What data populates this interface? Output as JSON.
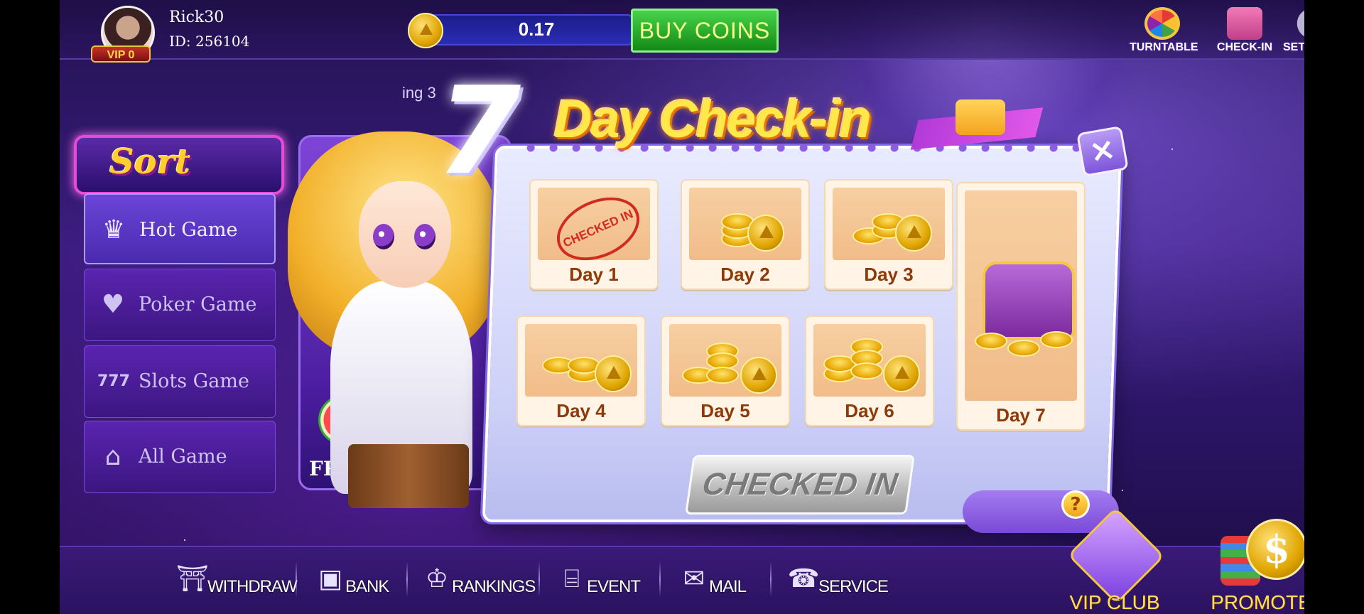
{
  "user": {
    "name": "Rick30",
    "id": "ID: 256104",
    "vip": "VIP 0"
  },
  "wallet": {
    "balance": "0.17",
    "buy_label": "BUY COINS"
  },
  "top_icons": [
    {
      "label": "TURNTABLE",
      "icon": "wheel-icon"
    },
    {
      "label": "CHECK-IN",
      "icon": "calendar-gift-icon"
    },
    {
      "label": "SETTINGS",
      "icon": "gear-icon"
    }
  ],
  "marquee": "ing 3",
  "sort": {
    "title": "Sort",
    "items": [
      {
        "label": "Hot Game",
        "icon": "crown-icon",
        "active": true
      },
      {
        "label": "Poker Game",
        "icon": "poker-card-icon",
        "active": false
      },
      {
        "label": "Slots Game",
        "icon": "slot-777-icon",
        "active": false
      },
      {
        "label": "All Game",
        "icon": "home-icon",
        "active": false
      }
    ]
  },
  "game_card": {
    "label": "FRU"
  },
  "checkin": {
    "title_number": "7",
    "title_text": "Day Check-in",
    "days": [
      {
        "label": "Day 1",
        "checked": true,
        "stamp": "CHECKED IN"
      },
      {
        "label": "Day 2",
        "checked": false
      },
      {
        "label": "Day 3",
        "checked": false
      },
      {
        "label": "Day 4",
        "checked": false
      },
      {
        "label": "Day 5",
        "checked": false
      },
      {
        "label": "Day 6",
        "checked": false
      },
      {
        "label": "Day 7",
        "checked": false
      }
    ],
    "button_label": "CHECKED IN",
    "help_label": "?",
    "close_label": "×"
  },
  "bottom_nav": [
    {
      "label": "WITHDRAW",
      "icon": "withdraw-icon"
    },
    {
      "label": "BANK",
      "icon": "safe-icon"
    },
    {
      "label": "RANKINGS",
      "icon": "trophy-icon"
    },
    {
      "label": "EVENT",
      "icon": "gift-icon"
    },
    {
      "label": "MAIL",
      "icon": "mail-icon"
    },
    {
      "label": "SERVICE",
      "icon": "telephone-icon"
    }
  ],
  "vip_club": {
    "label": "VIP CLUB"
  },
  "promote": {
    "label": "PROMOTE",
    "symbol": "$"
  }
}
